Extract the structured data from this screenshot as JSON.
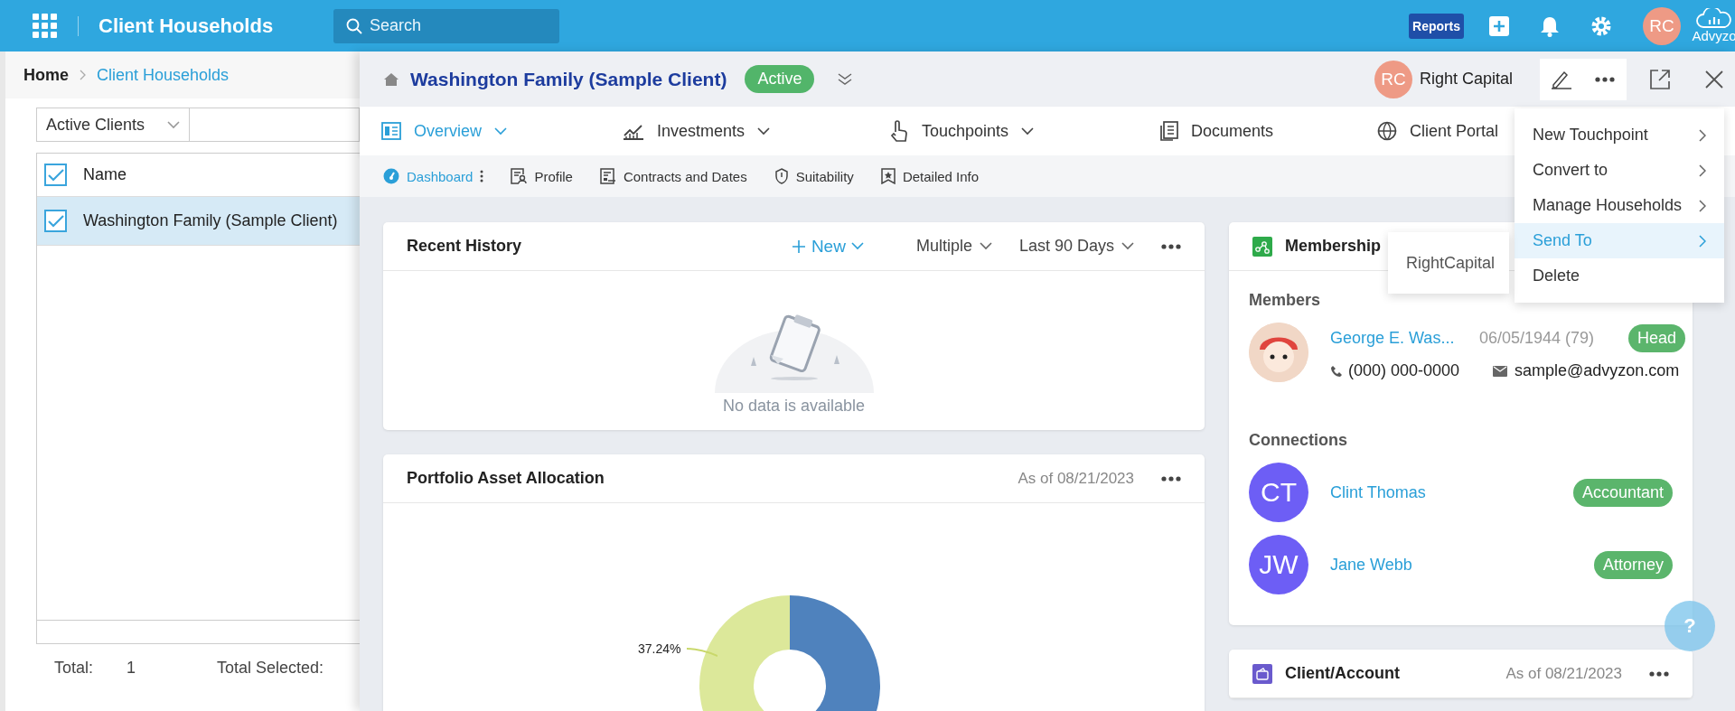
{
  "top_bar": {
    "title": "Client Households",
    "search": {
      "placeholder": "Search"
    },
    "reports": "Reports",
    "user_initials": "RC",
    "brand": "Advyzo"
  },
  "breadcrumb": [
    "Home",
    "Client Households"
  ],
  "list_panel": {
    "filter": "Active Clients",
    "header_checked": true,
    "columns": [
      "Name"
    ],
    "rows": [
      {
        "name": "Washington Family (Sample Client)",
        "checked": true,
        "selected": true
      }
    ],
    "total_label": "Total:",
    "total": "1",
    "total_selected_label": "Total Selected:"
  },
  "detail": {
    "title": "Washington Family (Sample Client)",
    "status": "Active",
    "advisor": {
      "initials": "RC",
      "name": "Right Capital"
    },
    "tabs": [
      {
        "label": "Overview",
        "selected": true,
        "has_menu": true
      },
      {
        "label": "Investments",
        "selected": false,
        "has_menu": true
      },
      {
        "label": "Touchpoints",
        "selected": false,
        "has_menu": true
      },
      {
        "label": "Documents",
        "selected": false,
        "has_menu": false
      },
      {
        "label": "Client Portal",
        "selected": false,
        "has_menu": false
      }
    ],
    "subtabs": [
      {
        "label": "Dashboard",
        "selected": true
      },
      {
        "label": "Profile",
        "selected": false
      },
      {
        "label": "Contracts and Dates",
        "selected": false
      },
      {
        "label": "Suitability",
        "selected": false
      },
      {
        "label": "Detailed Info",
        "selected": false
      }
    ],
    "recent_history": {
      "title": "Recent History",
      "new_label": "New",
      "filters": [
        "Multiple",
        "Last 90 Days"
      ],
      "empty_text": "No data is available"
    },
    "portfolio": {
      "title": "Portfolio Asset Allocation",
      "as_of": "As of 08/21/2023",
      "slice_label": "37.24%"
    },
    "membership": {
      "title": "Membership",
      "members_heading": "Members",
      "members": [
        {
          "name": "George E. Was...",
          "dob": "06/05/1944 (79)",
          "role": "Head",
          "phone": "(000) 000-0000",
          "email": "sample@advyzon.com"
        }
      ],
      "connections_heading": "Connections",
      "connections": [
        {
          "initials": "CT",
          "name": "Clint Thomas",
          "role": "Accountant"
        },
        {
          "initials": "JW",
          "name": "Jane Webb",
          "role": "Attorney"
        }
      ]
    },
    "client_account": {
      "title": "Client/Account",
      "as_of": "As of 08/21/2023"
    }
  },
  "action_menu": {
    "items": [
      {
        "label": "New Touchpoint",
        "has_submenu": true,
        "selected": false
      },
      {
        "label": "Convert to",
        "has_submenu": true,
        "selected": false
      },
      {
        "label": "Manage Households",
        "has_submenu": true,
        "selected": false
      },
      {
        "label": "Send To",
        "has_submenu": true,
        "selected": true
      },
      {
        "label": "Delete",
        "has_submenu": false,
        "selected": false
      }
    ],
    "submenu": [
      "RightCapital"
    ]
  },
  "help": {
    "label": "?"
  }
}
